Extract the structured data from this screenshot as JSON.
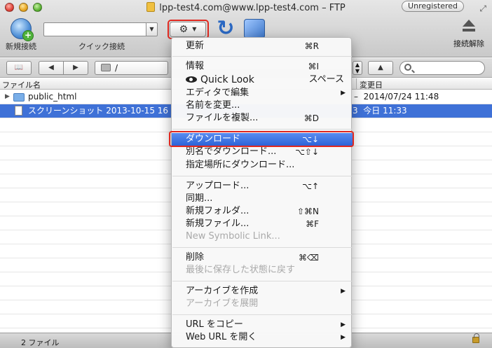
{
  "window": {
    "title": "lpp-test4.com@www.lpp-test4.com – FTP",
    "badge": "Unregistered"
  },
  "toolbar": {
    "new_connection_label": "新規接続",
    "quick_connect_label": "クイック接続",
    "quick_connect_value": "",
    "disconnect_label": "接続解除"
  },
  "pathbar": {
    "path": "/",
    "search_placeholder": ""
  },
  "columns": {
    "filename": "ファイル名",
    "modified": "変更日"
  },
  "files": [
    {
      "name": "public_html",
      "partial": "–",
      "modified": "2014/07/24 11:48",
      "type": "folder",
      "selected": false
    },
    {
      "name": "スクリーンショット 2013-10-15 16",
      "partial": "3",
      "modified": "今日 11:33",
      "type": "file",
      "selected": true
    }
  ],
  "status": {
    "count": "2 ファイル"
  },
  "menu": {
    "refresh": {
      "label": "更新",
      "shortcut": "⌘R"
    },
    "info": {
      "label": "情報",
      "shortcut": "⌘I"
    },
    "quicklook": {
      "label": "Quick Look",
      "shortcut": "スペース"
    },
    "edit": {
      "label": "エディタで編集"
    },
    "rename": {
      "label": "名前を変更..."
    },
    "duplicate": {
      "label": "ファイルを複製...",
      "shortcut": "⌘D"
    },
    "download": {
      "label": "ダウンロード",
      "shortcut": "⌥↓"
    },
    "download_as": {
      "label": "別名でダウンロード...",
      "shortcut": "⌥⇧↓"
    },
    "download_to": {
      "label": "指定場所にダウンロード..."
    },
    "upload": {
      "label": "アップロード...",
      "shortcut": "⌥↑"
    },
    "sync": {
      "label": "同期..."
    },
    "new_folder": {
      "label": "新規フォルダ...",
      "shortcut": "⇧⌘N"
    },
    "new_file": {
      "label": "新規ファイル...",
      "shortcut": "⌘F"
    },
    "new_symlink": {
      "label": "New Symbolic Link..."
    },
    "delete": {
      "label": "削除",
      "shortcut": "⌘⌫"
    },
    "revert": {
      "label": "最後に保存した状態に戻す"
    },
    "create_archive": {
      "label": "アーカイブを作成"
    },
    "expand_archive": {
      "label": "アーカイブを展開"
    },
    "copy_url": {
      "label": "URL をコピー"
    },
    "open_web_url": {
      "label": "Web URL を開く"
    }
  },
  "colors": {
    "selection": "#3f71d7",
    "highlight_frame": "#e0281f",
    "menu_highlight": "#2c63d8"
  }
}
